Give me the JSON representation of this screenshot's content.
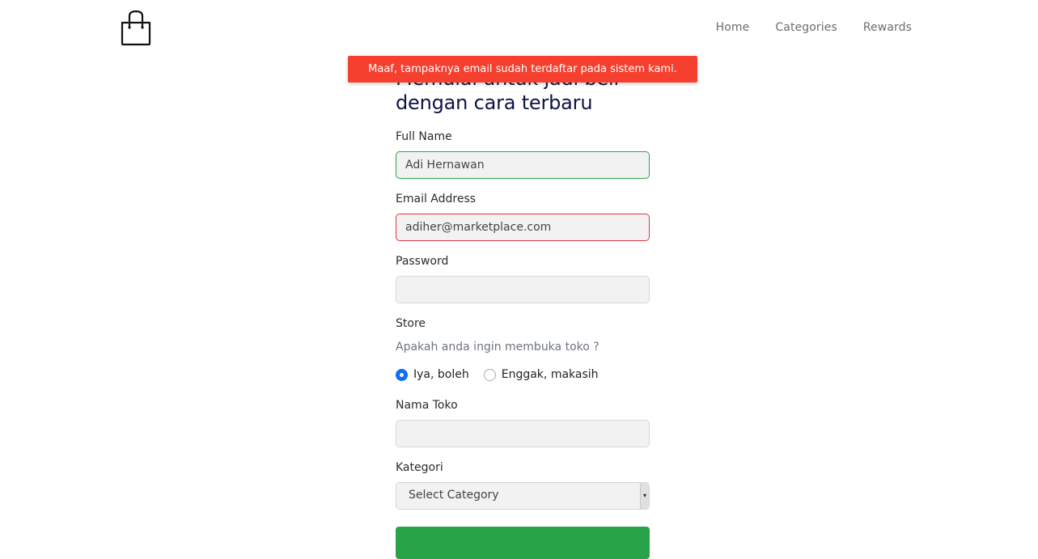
{
  "nav": {
    "links": [
      "Home",
      "Categories",
      "Rewards"
    ]
  },
  "toast": {
    "message": "Maaf, tampaknya email sudah terdaftar pada sistem kami."
  },
  "form": {
    "title_line1": "Memulai untuk jadi beli",
    "title_line2": "dengan cara terbaru",
    "full_name": {
      "label": "Full Name",
      "value": "Adi Hernawan"
    },
    "email": {
      "label": "Email Address",
      "value": "adiher@marketplace.com"
    },
    "password": {
      "label": "Password",
      "value": ""
    },
    "store": {
      "label": "Store",
      "hint": "Apakah anda ingin membuka toko ?",
      "options": [
        "Iya, boleh",
        "Enggak, makasih"
      ],
      "selected": "Iya, boleh"
    },
    "store_name": {
      "label": "Nama Toko",
      "value": ""
    },
    "category": {
      "label": "Kategori",
      "selected": "Select Category"
    }
  },
  "colors": {
    "toast_bg": "#f5402f",
    "title": "#0c1446",
    "valid_border": "#28a745",
    "invalid_border": "#dc3545",
    "submit_bg": "#29a347",
    "radio_accent": "#0d6efd"
  },
  "icons": {
    "logo": "shopping-bag-icon",
    "select_arrow": "dropdown-arrow-icon"
  }
}
